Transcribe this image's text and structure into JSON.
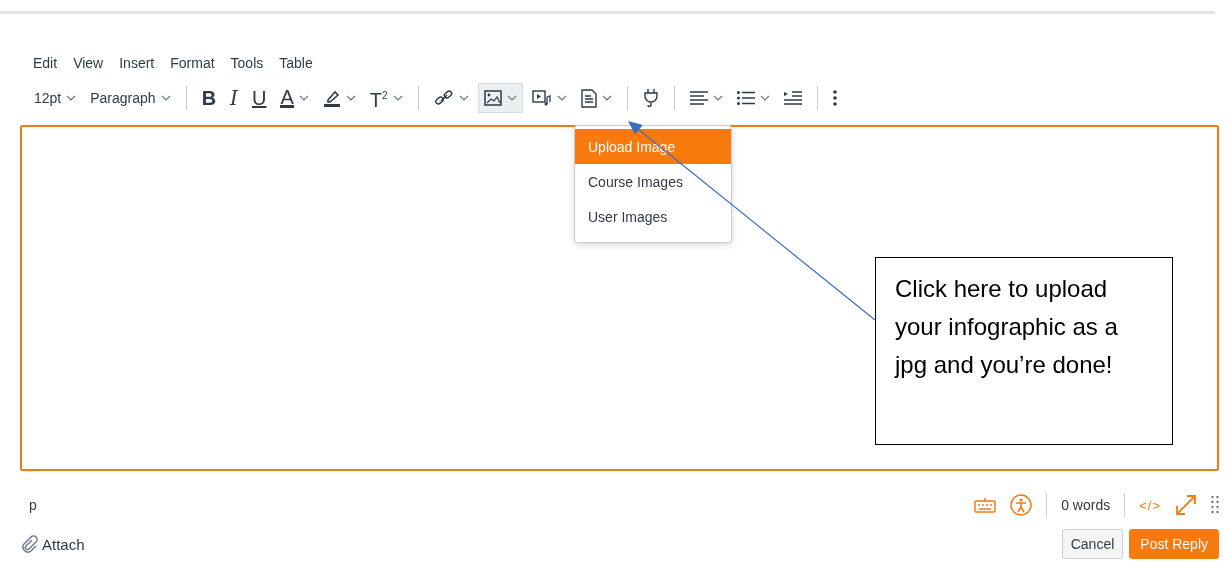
{
  "menubar": [
    "Edit",
    "View",
    "Insert",
    "Format",
    "Tools",
    "Table"
  ],
  "toolbar": [
    [
      {
        "kind": "dropdown",
        "label": "12pt",
        "selected": false
      },
      {
        "kind": "dropdown",
        "label": "Paragraph",
        "selected": false
      }
    ],
    [
      {
        "kind": "glyph",
        "glyph": "B",
        "selected": false
      },
      {
        "kind": "glyph",
        "glyph": "I",
        "selected": false
      },
      {
        "kind": "glyph",
        "glyph": "U",
        "selected": false
      },
      {
        "kind": "glyph",
        "glyph": "A",
        "selected": false
      },
      {
        "kind": "icon",
        "selected": false
      },
      {
        "kind": "glyph",
        "glyph": "T$^{2}$",
        "selected": false
      }
    ],
    [
      {
        "kind": "icon",
        "selected": false
      },
      {
        "kind": "icon",
        "selected": true
      },
      {
        "kind": "icon",
        "selected": false
      },
      {
        "kind": "icon",
        "selected": false
      }
    ],
    [
      {
        "kind": "icon",
        "selected": false
      }
    ],
    [
      {
        "kind": "icon",
        "selected": false
      },
      {
        "kind": "icon",
        "selected": false
      },
      {
        "kind": "icon",
        "selected": false
      }
    ],
    [
      {
        "kind": "icon",
        "selected": false
      }
    ]
  ],
  "image_menu": [
    {
      "label": "Upload Image",
      "selected": true
    },
    {
      "label": "Course Images",
      "selected": false
    },
    {
      "label": "User Images",
      "selected": false
    }
  ],
  "callout": {
    "text": "Click here to upload your infographic as a jpg and you’re done!"
  },
  "status_bar": {
    "path": "p",
    "word_count": "0 words",
    "code_toggle": "</>"
  },
  "attach": "Attach",
  "buttons": [
    {
      "label": "Cancel",
      "kind": "secondary"
    },
    {
      "label": "Post Reply",
      "kind": "primary"
    }
  ]
}
